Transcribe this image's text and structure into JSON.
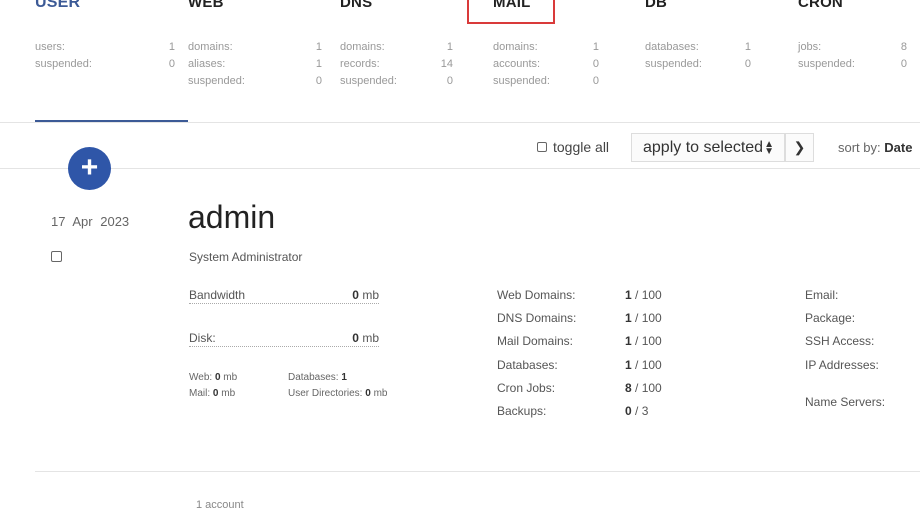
{
  "tabs": [
    {
      "title": "USER",
      "stats": [
        {
          "k": "users:",
          "v": "1"
        },
        {
          "k": "suspended:",
          "v": "0"
        }
      ]
    },
    {
      "title": "WEB",
      "stats": [
        {
          "k": "domains:",
          "v": "1"
        },
        {
          "k": "aliases:",
          "v": "1"
        },
        {
          "k": "suspended:",
          "v": "0"
        }
      ]
    },
    {
      "title": "DNS",
      "stats": [
        {
          "k": "domains:",
          "v": "1"
        },
        {
          "k": "records:",
          "v": "14"
        },
        {
          "k": "suspended:",
          "v": "0"
        }
      ]
    },
    {
      "title": "MAIL",
      "stats": [
        {
          "k": "domains:",
          "v": "1"
        },
        {
          "k": "accounts:",
          "v": "0"
        },
        {
          "k": "suspended:",
          "v": "0"
        }
      ]
    },
    {
      "title": "DB",
      "stats": [
        {
          "k": "databases:",
          "v": "1"
        },
        {
          "k": "suspended:",
          "v": "0"
        }
      ]
    },
    {
      "title": "CRON",
      "stats": [
        {
          "k": "jobs:",
          "v": "8"
        },
        {
          "k": "suspended:",
          "v": "0"
        }
      ]
    }
  ],
  "toolbar": {
    "toggle_all": "toggle all",
    "apply_selected": "apply to selected",
    "sort_label": "sort by:",
    "sort_value": "Date"
  },
  "add_button": "+",
  "record": {
    "date_day": "17",
    "date_month": "Apr",
    "date_year": "2023",
    "username": "admin",
    "full_name": "System Administrator",
    "bandwidth_label": "Bandwidth",
    "bandwidth_value": "0",
    "bandwidth_unit": "mb",
    "disk_label": "Disk",
    "disk_value": "0",
    "disk_unit": "mb",
    "web_label": "Web:",
    "web_value": "0",
    "web_unit": "mb",
    "mail_label": "Mail:",
    "mail_value": "0",
    "mail_unit": "mb",
    "databases_label": "Databases:",
    "databases_value": "1",
    "userdirs_label": "User Directories:",
    "userdirs_value": "0",
    "userdirs_unit": "mb",
    "limits": [
      {
        "k": "Web Domains:",
        "used": "1",
        "max": "/ 100"
      },
      {
        "k": "DNS Domains:",
        "used": "1",
        "max": "/ 100"
      },
      {
        "k": "Mail Domains:",
        "used": "1",
        "max": "/ 100"
      },
      {
        "k": "Databases:",
        "used": "1",
        "max": "/ 100"
      },
      {
        "k": "Cron Jobs:",
        "used": "8",
        "max": "/ 100"
      },
      {
        "k": "Backups:",
        "used": "0",
        "max": "/ 3"
      }
    ],
    "info_labels": [
      "Email:",
      "Package:",
      "SSH Access:",
      "IP Addresses:",
      "Name Servers:"
    ]
  },
  "footer": "1 account",
  "colors": {
    "accent": "#2f56a8",
    "highlight_box": "#d93a3a"
  }
}
